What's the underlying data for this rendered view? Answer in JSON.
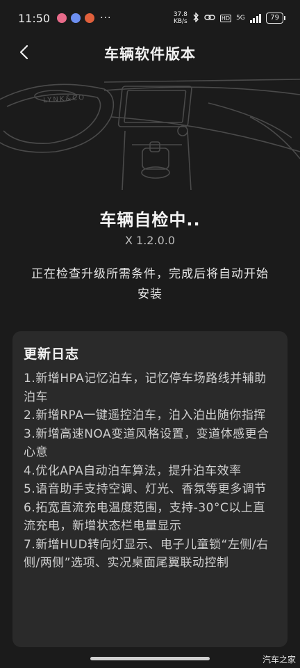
{
  "status_bar": {
    "time": "11:50",
    "more": "···",
    "net_speed_value": "37.8",
    "net_speed_unit": "KB/s",
    "hd": "HD",
    "network": "5G",
    "battery": "79",
    "icons": [
      "bluetooth-icon",
      "link-icon",
      "signal-icon"
    ],
    "app_dot_colors": [
      "#e86b8a",
      "#6d8ff0",
      "#e0603c"
    ]
  },
  "nav": {
    "title": "车辆软件版本",
    "back_icon": "chevron-left-icon"
  },
  "illustration": {
    "brand_text": "LYNK&CO"
  },
  "update_status": {
    "title": "车辆自检中..",
    "version": "X 1.2.0.0",
    "description": "正在检查升级所需条件，完成后将自动开始安装"
  },
  "changelog": {
    "title": "更新日志",
    "items": [
      "1.新增HPA记忆泊车，记忆停车场路线并辅助泊车",
      "2.新增RPA一键遥控泊车，泊入泊出随你指挥",
      "3.新增高速NOA变道风格设置，变道体感更合心意",
      "4.优化APA自动泊车算法，提升泊车效率",
      "5.语音助手支持空调、灯光、香氛等更多调节",
      "6.拓宽直流充电温度范围，支持-30°C以上直流充电，新增状态栏电量显示",
      "7.新增HUD转向灯显示、电子儿童锁“左侧/右侧/两侧”选项、实况桌面尾翼联动控制"
    ]
  },
  "watermark": "汽车之家"
}
